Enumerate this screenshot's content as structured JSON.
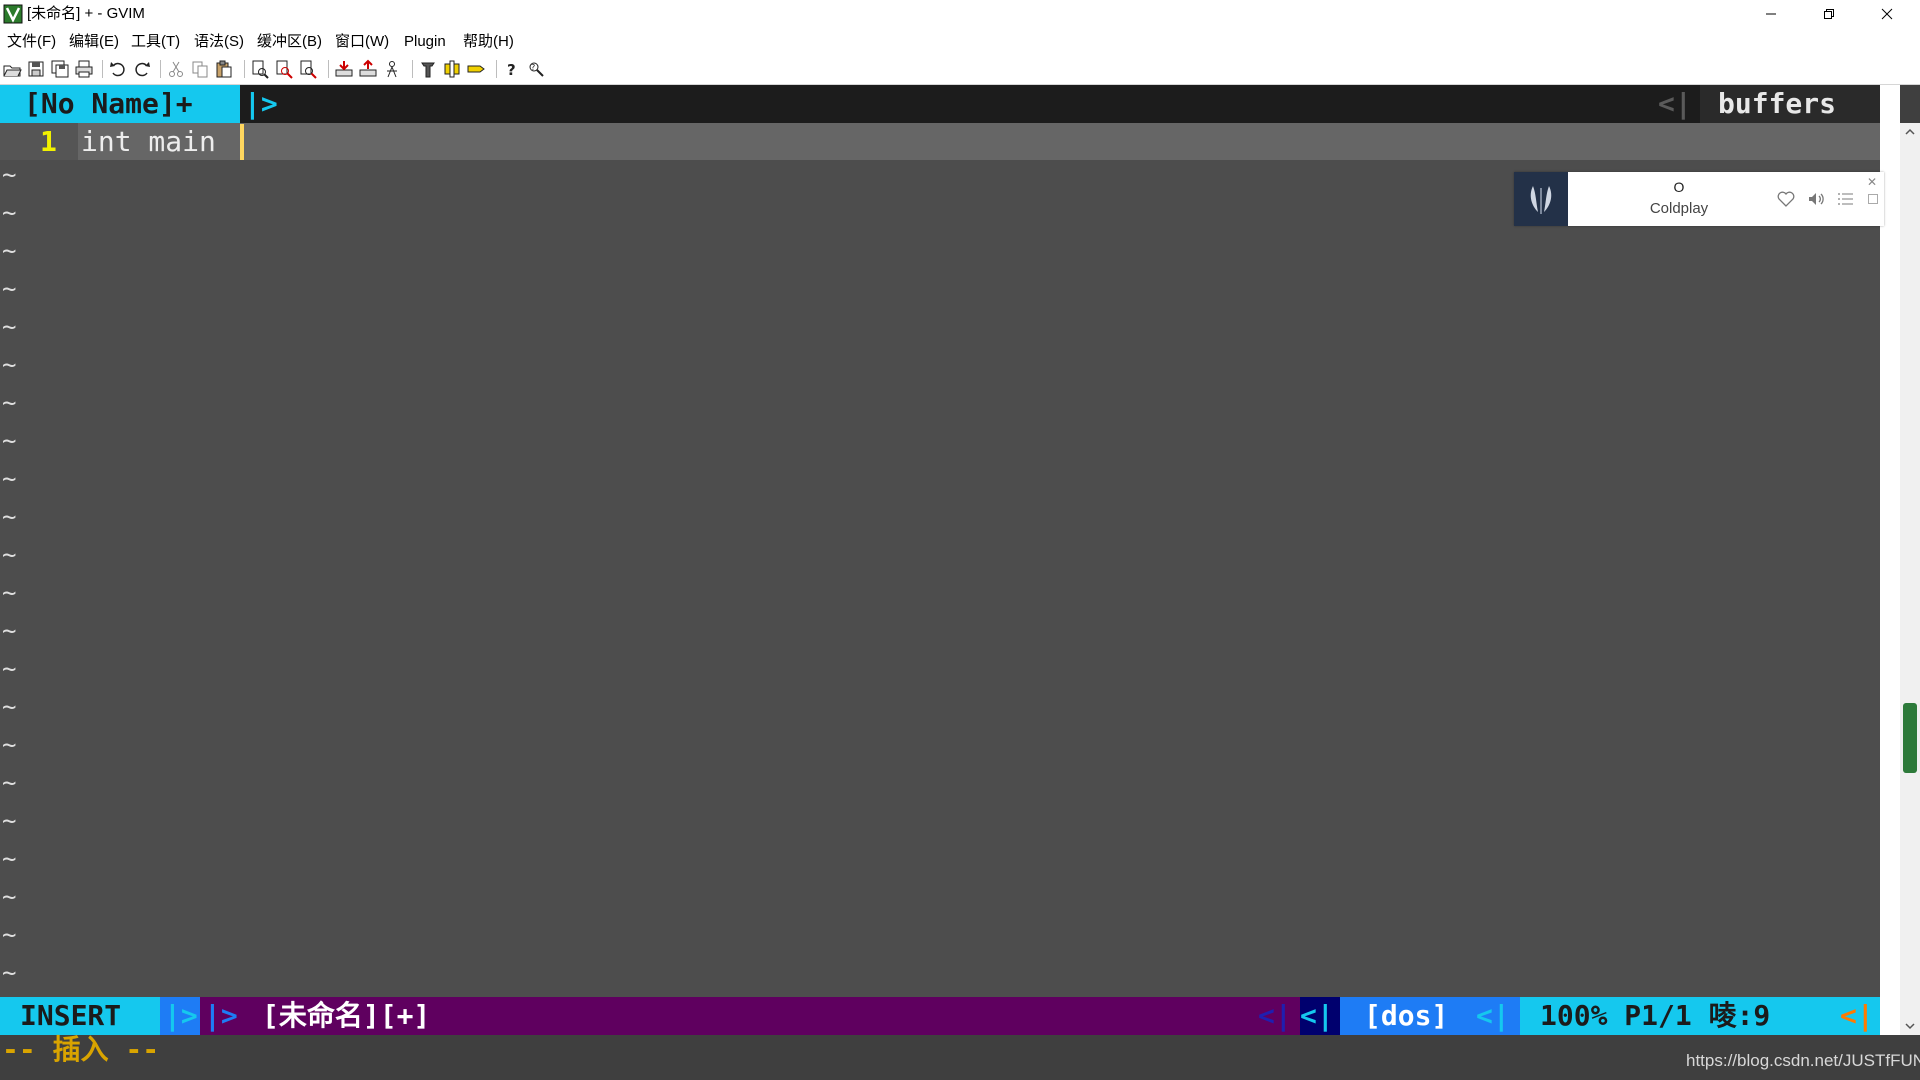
{
  "window": {
    "title": "[未命名] + - GVIM"
  },
  "menu": [
    {
      "label": "文件(F)"
    },
    {
      "label": "编辑(E)"
    },
    {
      "label": "工具(T)"
    },
    {
      "label": "语法(S)"
    },
    {
      "label": "缓冲区(B)"
    },
    {
      "label": "窗口(W)"
    },
    {
      "label": "Plugin"
    },
    {
      "label": "帮助(H)"
    }
  ],
  "toolbar": {
    "icons": [
      "open-icon",
      "save-icon",
      "save-all-icon",
      "print-icon",
      "undo-icon",
      "redo-icon",
      "cut-icon",
      "copy-icon",
      "paste-icon",
      "find-replace-icon",
      "find-next-icon",
      "find-prev-icon",
      "load-session-icon",
      "save-session-icon",
      "run-script-icon",
      "make-icon",
      "shell-icon",
      "tags-icon",
      "help-icon",
      "find-help-icon"
    ]
  },
  "tabline": {
    "active_tab": "[No Name]+",
    "separator": "|>",
    "left_separator": "<|",
    "buffers_label": "buffers"
  },
  "editor": {
    "line_number": "1",
    "line_text": "int main",
    "empty_marker": "~",
    "colors": {
      "background": "#4d4d4d",
      "cursorline": "#666666",
      "line_number": "#f1f100",
      "cursor": "#ffd75f"
    }
  },
  "music_widget": {
    "title": "O",
    "artist": "Coldplay",
    "close": "✕"
  },
  "statusline": {
    "mode": "INSERT",
    "sep_a": "|>",
    "sep_b": "|>",
    "filename": "[未命名][+]",
    "sep_c": "<|",
    "sep_d": "<|",
    "fileformat": "[dos]",
    "sep_e": "<|",
    "position": "100% P1/1 㖫:9",
    "sep_f": "<|",
    "colors": {
      "mode_bg": "#15c8ee",
      "bar_bg": "#5f005f",
      "fileformat_bg": "#1e7cf5"
    }
  },
  "cmdline": {
    "text": "-- 插入 --"
  },
  "watermark": "https://blog.csdn.net/JUSTfFUN"
}
